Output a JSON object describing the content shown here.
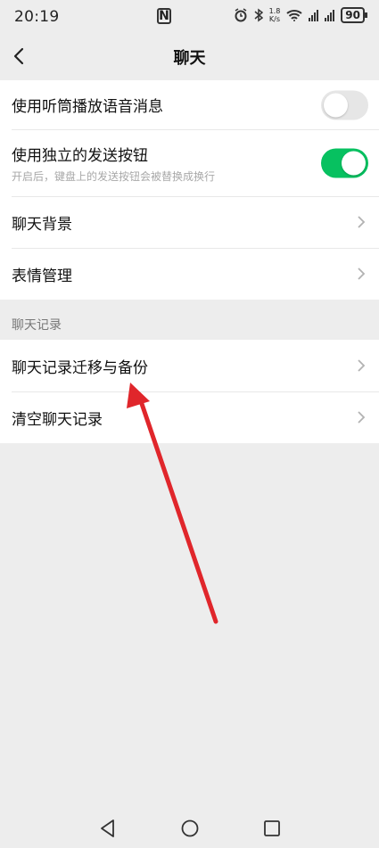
{
  "status_bar": {
    "time": "20:19",
    "nfc": "N",
    "speed_top": "1.8",
    "speed_bottom": "K/s",
    "battery": "90"
  },
  "nav": {
    "title": "聊天"
  },
  "settings_group_1": {
    "items": [
      {
        "title": "使用听筒播放语音消息",
        "toggle": false
      },
      {
        "title": "使用独立的发送按钮",
        "subtitle": "开启后，键盘上的发送按钮会被替换成换行",
        "toggle": true
      },
      {
        "title": "聊天背景"
      },
      {
        "title": "表情管理"
      }
    ]
  },
  "section": {
    "header": "聊天记录"
  },
  "settings_group_2": {
    "items": [
      {
        "title": "聊天记录迁移与备份"
      },
      {
        "title": "清空聊天记录"
      }
    ]
  },
  "colors": {
    "accent": "#07c160",
    "annotation_arrow": "#e0262b",
    "background": "#ededed"
  }
}
